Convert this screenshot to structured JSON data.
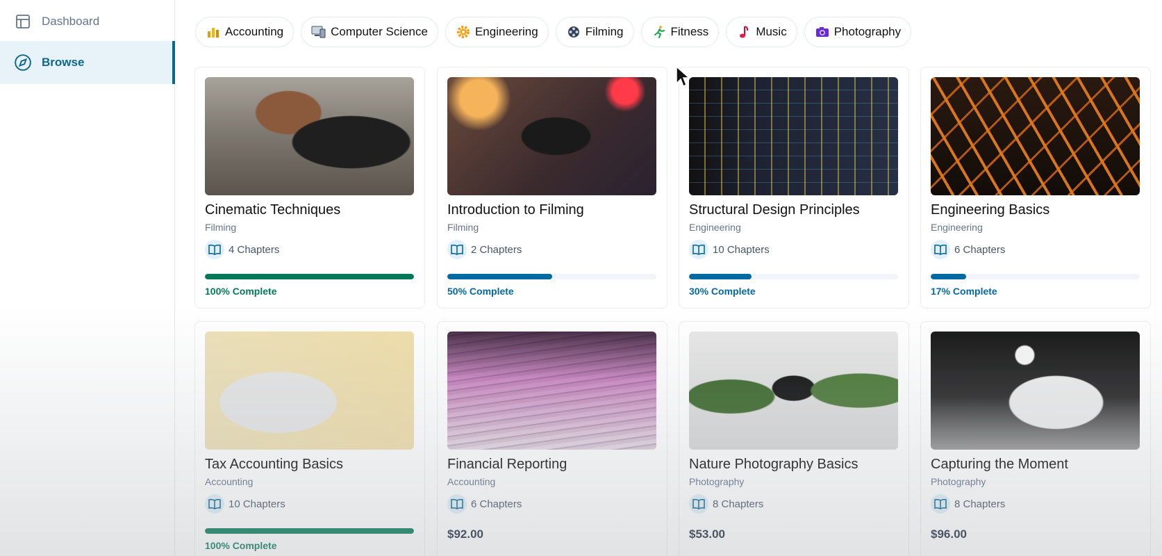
{
  "sidebar": {
    "items": [
      {
        "label": "Dashboard",
        "icon": "layout-icon",
        "active": false
      },
      {
        "label": "Browse",
        "icon": "compass-icon",
        "active": true
      }
    ]
  },
  "categories": [
    {
      "label": "Accounting",
      "icon": "bar-chart-icon"
    },
    {
      "label": "Computer Science",
      "icon": "computer-icon"
    },
    {
      "label": "Engineering",
      "icon": "gear-icon"
    },
    {
      "label": "Filming",
      "icon": "film-reel-icon"
    },
    {
      "label": "Fitness",
      "icon": "runner-icon"
    },
    {
      "label": "Music",
      "icon": "music-note-icon"
    },
    {
      "label": "Photography",
      "icon": "camera-icon"
    }
  ],
  "courses": [
    {
      "title": "Cinematic Techniques",
      "category": "Filming",
      "chapters": "4 Chapters",
      "progress": 100,
      "progress_label": "100% Complete",
      "image": "video-camera-photo"
    },
    {
      "title": "Introduction to Filming",
      "category": "Filming",
      "chapters": "2 Chapters",
      "progress": 50,
      "progress_label": "50% Complete",
      "image": "camera-rig-photo"
    },
    {
      "title": "Structural Design Principles",
      "category": "Engineering",
      "chapters": "10 Chapters",
      "progress": 30,
      "progress_label": "30% Complete",
      "image": "cad-screen-photo"
    },
    {
      "title": "Engineering Basics",
      "category": "Engineering",
      "chapters": "6 Chapters",
      "progress": 17,
      "progress_label": "17% Complete",
      "image": "steel-truss-photo"
    },
    {
      "title": "Tax Accounting Basics",
      "category": "Accounting",
      "chapters": "10 Chapters",
      "progress": 100,
      "progress_label": "100% Complete",
      "image": "calculator-photo"
    },
    {
      "title": "Financial Reporting",
      "category": "Accounting",
      "chapters": "6 Chapters",
      "price": "$92.00",
      "image": "paper-stack-photo"
    },
    {
      "title": "Nature Photography Basics",
      "category": "Photography",
      "chapters": "8 Chapters",
      "price": "$53.00",
      "image": "camera-plant-photo"
    },
    {
      "title": "Capturing the Moment",
      "category": "Photography",
      "chapters": "8 Chapters",
      "price": "$96.00",
      "image": "studio-photo"
    }
  ],
  "colors": {
    "accent": "#0b6690",
    "progress_blue": "#0369a1",
    "progress_complete": "#047857"
  }
}
